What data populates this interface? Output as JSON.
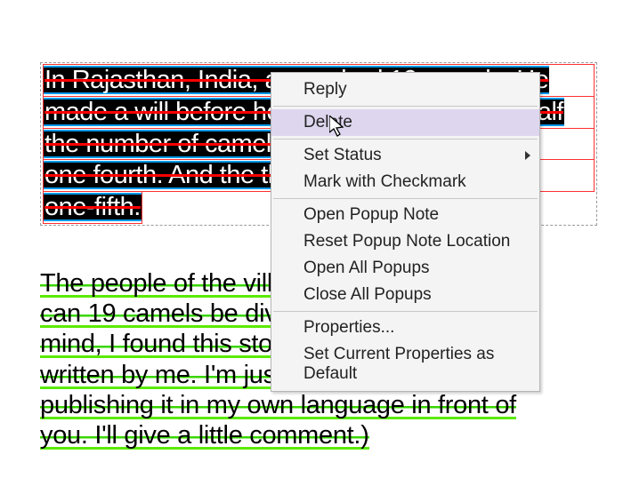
{
  "text": {
    "para1": {
      "l1": "In Rajasthan, India, a man had 19 camels. He",
      "l2": "made a will before he died, \"I'll give my first half",
      "l3": "the number of camels. The second will give",
      "l4": "one fourth. And the third will be given",
      "l5": "one-fifth."
    },
    "para2": {
      "l1": "The people of the village came to think. How",
      "l2": "can 19 camels be divided? Keeping you in",
      "l3": "mind, I found this story. This story is not",
      "l4": "written by me. I'm just typing the matter and",
      "l5": "publishing it in my own language in front of",
      "l6": "you. I'll give a little comment.)"
    }
  },
  "menu": {
    "reply": "Reply",
    "delete": "Delete",
    "set_status": "Set Status",
    "mark_check": "Mark with Checkmark",
    "open_popup": "Open Popup Note",
    "reset_popup": "Reset Popup Note Location",
    "open_all": "Open All Popups",
    "close_all": "Close All Popups",
    "properties": "Properties...",
    "set_default": "Set Current Properties as Default"
  }
}
